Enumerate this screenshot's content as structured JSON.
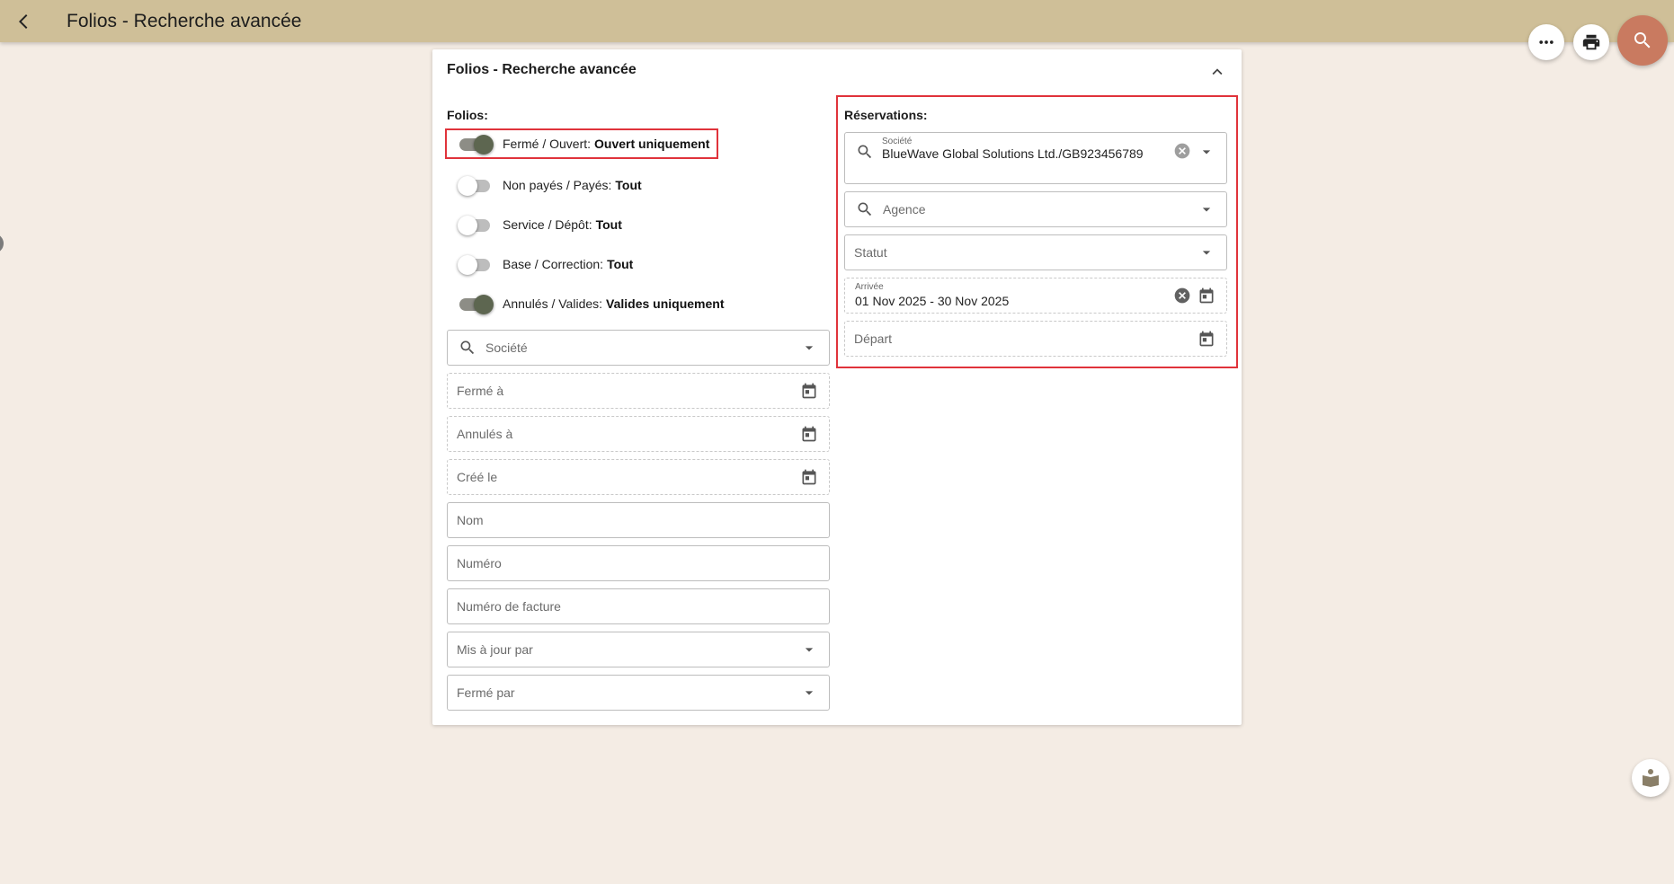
{
  "header": {
    "title": "Folios - Recherche avancée"
  },
  "card": {
    "title": "Folios - Recherche avancée",
    "folios_label": "Folios:",
    "toggles": [
      {
        "label": "Fermé / Ouvert:",
        "value": "Ouvert uniquement",
        "on": true
      },
      {
        "label": "Non payés / Payés:",
        "value": "Tout",
        "on": false
      },
      {
        "label": "Service / Dépôt:",
        "value": "Tout",
        "on": false
      },
      {
        "label": "Base / Correction:",
        "value": "Tout",
        "on": false
      },
      {
        "label": "Annulés / Valides:",
        "value": "Valides uniquement",
        "on": true
      }
    ],
    "fields": {
      "societe": "Société",
      "ferme_a": "Fermé à",
      "annules_a": "Annulés à",
      "cree_le": "Créé le",
      "nom": "Nom",
      "numero": "Numéro",
      "numero_facture": "Numéro de facture",
      "mis_a_jour_par": "Mis à jour par",
      "ferme_par": "Fermé par"
    },
    "reservations": {
      "label": "Réservations:",
      "societe_label": "Société",
      "societe_value": "BlueWave Global Solutions Ltd./GB923456789",
      "agence": "Agence",
      "statut": "Statut",
      "arrivee_label": "Arrivée",
      "arrivee_value": "01 Nov 2025 - 30 Nov 2025",
      "depart": "Départ"
    }
  },
  "colors": {
    "accent_bar": "#cfbf98",
    "search_fab": "#c97a60",
    "highlight": "#e0333b",
    "background": "#f4ece4"
  }
}
